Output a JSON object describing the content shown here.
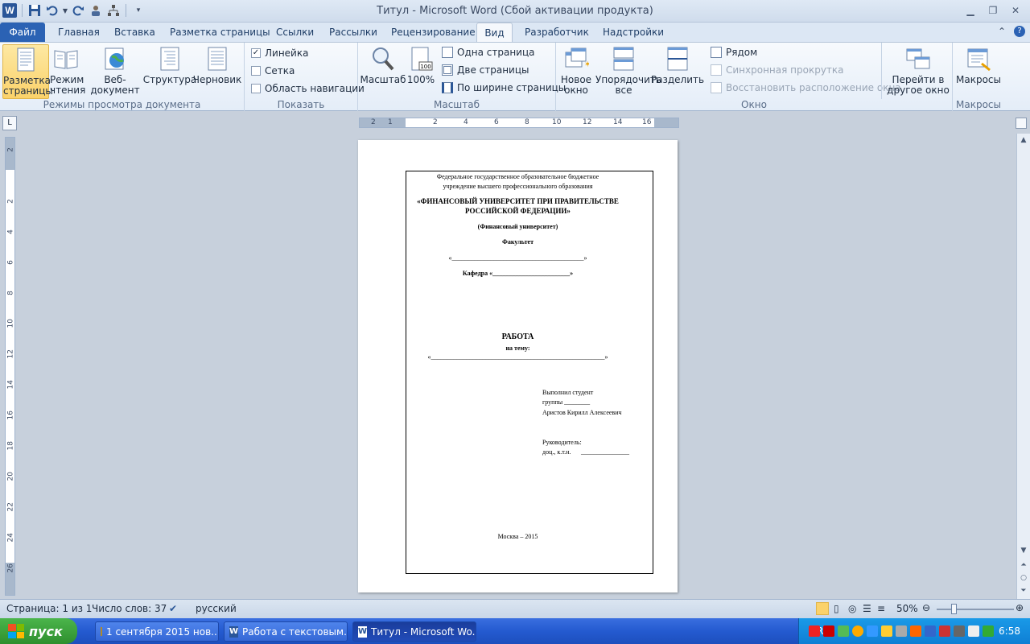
{
  "window": {
    "title": "Титул - Microsoft Word (Сбой активации продукта)"
  },
  "tabs": {
    "file": "Файл",
    "items": [
      "Главная",
      "Вставка",
      "Разметка страницы",
      "Ссылки",
      "Рассылки",
      "Рецензирование",
      "Вид",
      "Разработчик",
      "Надстройки"
    ],
    "active": "Вид"
  },
  "ribbon": {
    "views": {
      "label": "Режимы просмотра документа",
      "print_layout": "Разметка страницы",
      "reading": "Режим чтения",
      "web": "Веб-документ",
      "outline": "Структура",
      "draft": "Черновик"
    },
    "show": {
      "label": "Показать",
      "ruler": "Линейка",
      "ruler_checked": true,
      "grid": "Сетка",
      "grid_checked": false,
      "nav": "Область навигации",
      "nav_checked": false
    },
    "zoom": {
      "label": "Масштаб",
      "zoom": "Масштаб",
      "hundred": "100%",
      "one_page": "Одна страница",
      "two_pages": "Две страницы",
      "page_width": "По ширине страницы"
    },
    "window": {
      "label": "Окно",
      "new_window": "Новое окно",
      "arrange": "Упорядочить все",
      "split": "Разделить",
      "side_by_side": "Рядом",
      "sync_scroll": "Синхронная прокрутка",
      "reset_pos": "Восстановить расположение окна",
      "switch": "Перейти в другое окно"
    },
    "macros": {
      "label": "Макросы",
      "macros": "Макросы"
    }
  },
  "document": {
    "line1": "Федеральное государственное образовательное бюджетное",
    "line2": "учреждение высшего профессионального образования",
    "univ1": "«ФИНАНСОВЫЙ УНИВЕРСИТЕТ ПРИ ПРАВИТЕЛЬСТВЕ",
    "univ2": "РОССИЙСКОЙ ФЕДЕРАЦИИ»",
    "short": "(Финансовый университет)",
    "faculty": "Факультет",
    "faculty_blank": "«_________________________________________»",
    "dept": "Кафедра «________________________»",
    "work": "РАБОТА",
    "topic": "на тему:",
    "topic_blank": "«______________________________________________________»",
    "done_by": "Выполнил студент",
    "group": "группы ________",
    "student": "Аристов Кирилл Алексеевич",
    "supervisor": "Руководитель:",
    "supervisor_title": "доц., к.т.н.",
    "supervisor_blank": "_______________",
    "city_year": "Москва – 2015"
  },
  "ruler": {
    "h_numbers": [
      "2",
      "1",
      "2",
      "4",
      "6",
      "8",
      "10",
      "12",
      "14",
      "16"
    ],
    "v_numbers": [
      "2",
      "2",
      "4",
      "6",
      "8",
      "10",
      "12",
      "14",
      "16",
      "18",
      "20",
      "22",
      "24",
      "26"
    ]
  },
  "status": {
    "page": "Страница: 1 из 1",
    "words": "Число слов: 37",
    "lang": "русский",
    "zoom": "50%"
  },
  "taskbar": {
    "start": "пуск",
    "buttons": [
      "1 сентября 2015 нов...",
      "Работа с текстовым...",
      "Титул - Microsoft Wo..."
    ],
    "lang": "RL",
    "clock": "6:58"
  }
}
